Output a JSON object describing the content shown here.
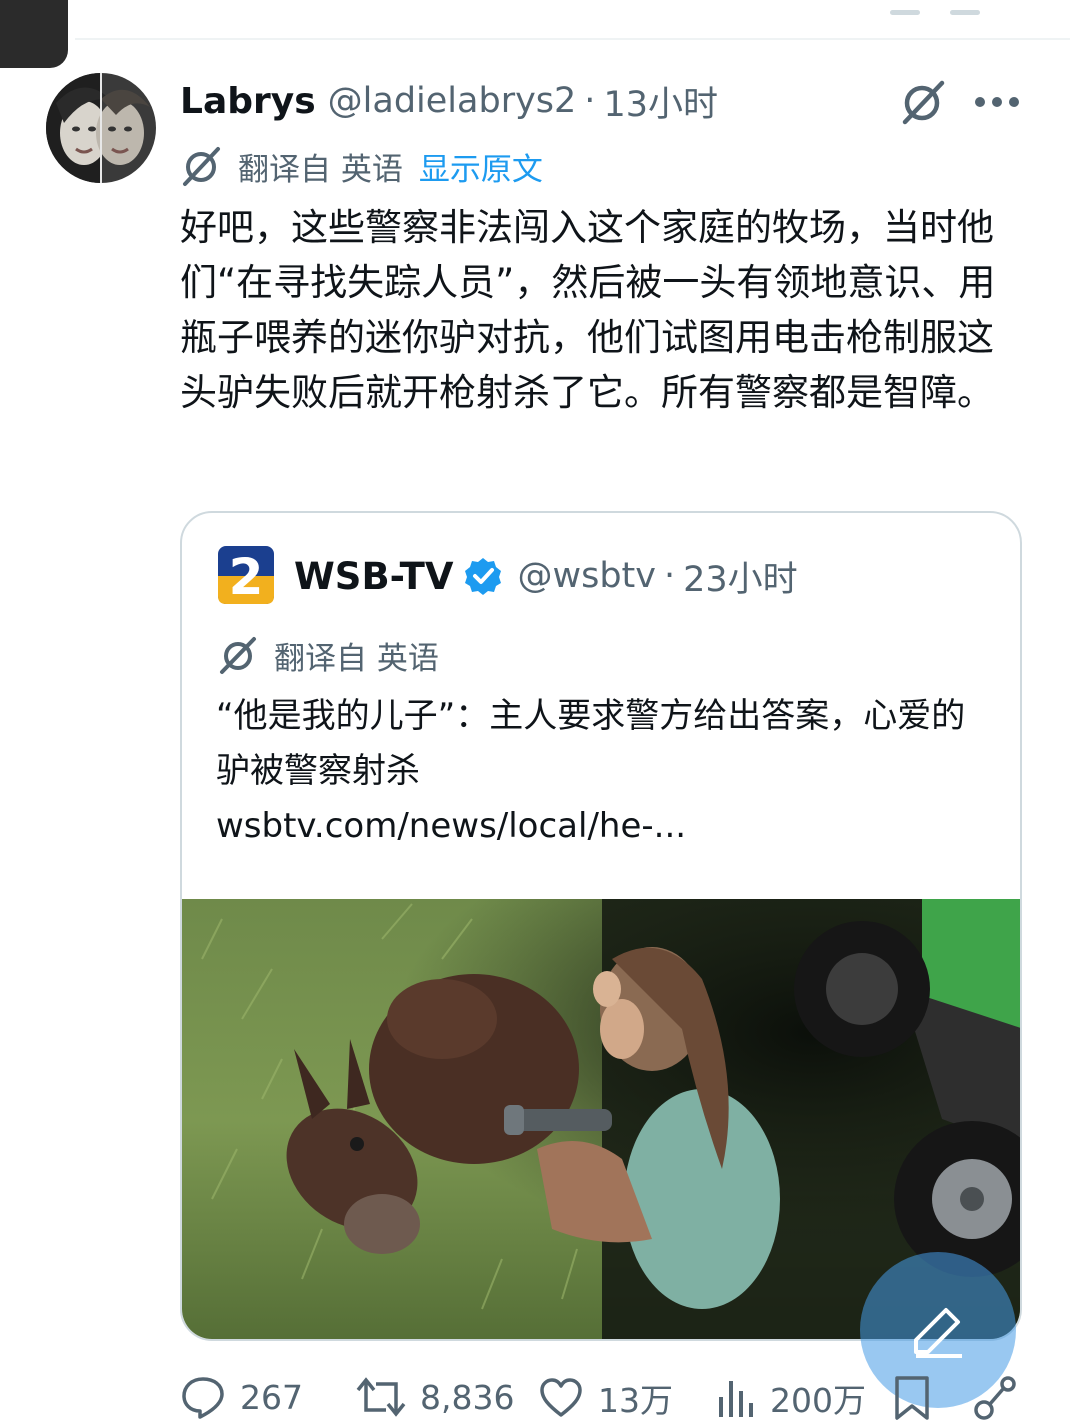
{
  "tweet": {
    "name": "Labrys",
    "handle": "@ladielabrys2",
    "dot": "·",
    "time": "13小时",
    "translated_from": "翻译自 英语",
    "show_original": "显示原文",
    "body": "好吧，这些警察非法闯入这个家庭的牧场，当时他们“在寻找失踪人员”，然后被一头有领地意识、用瓶子喂养的迷你驴对抗，他们试图用电击枪制服这头驴失败后就开枪射杀了它。所有警察都是智障。"
  },
  "quote": {
    "logo_text": "2",
    "name": "WSB-TV",
    "handle": "@wsbtv",
    "dot": "·",
    "time": "23小时",
    "translated_from": "翻译自 英语",
    "text": "“他是我的儿子”：主人要求警方给出答案，心爱的驴被警察射杀",
    "url": "wsbtv.com/news/local/he-..."
  },
  "actions": {
    "replies": "267",
    "reposts": "8,836",
    "likes": "13万",
    "views": "200万"
  },
  "colors": {
    "link": "#1d9bf0",
    "secondary_text": "#536471",
    "border": "#cfd9de",
    "verified": "#1d9bf0"
  },
  "icons": [
    "grok-icon",
    "more-icon",
    "translate-icon",
    "verified-icon",
    "reply-icon",
    "repost-icon",
    "like-icon",
    "views-icon",
    "bookmark-icon",
    "share-icon",
    "compose-icon"
  ]
}
